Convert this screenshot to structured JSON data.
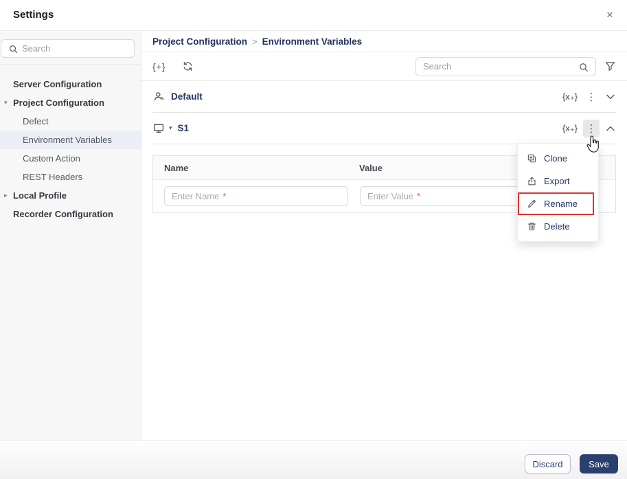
{
  "window": {
    "title": "Settings"
  },
  "icons": {
    "close": "×",
    "braces_add": "{+}",
    "x_add": "{x₊}",
    "kebab": "⋮",
    "caret_down": "▾",
    "caret_right": "▸"
  },
  "sidebar": {
    "search": {
      "placeholder": "Search"
    },
    "items": [
      {
        "label": "Server Configuration"
      },
      {
        "label": "Project Configuration"
      },
      {
        "label": "Defect"
      },
      {
        "label": "Environment Variables"
      },
      {
        "label": "Custom Action"
      },
      {
        "label": "REST Headers"
      },
      {
        "label": "Local Profile"
      },
      {
        "label": "Recorder Configuration"
      }
    ]
  },
  "breadcrumb": {
    "parent": "Project Configuration",
    "separator": ">",
    "current": "Environment Variables"
  },
  "toolbar": {
    "search_placeholder": "Search"
  },
  "sections": [
    {
      "name": "Default",
      "state": "collapsed"
    },
    {
      "name": "S1",
      "state": "expanded"
    }
  ],
  "table": {
    "columns": [
      {
        "label": "Name"
      },
      {
        "label": "Value"
      }
    ],
    "new_row": {
      "name_placeholder": "Enter Name",
      "value_placeholder": "Enter Value",
      "required_mark": "*"
    }
  },
  "context_menu": {
    "items": [
      {
        "label": "Clone"
      },
      {
        "label": "Export"
      },
      {
        "label": "Rename",
        "highlighted": true
      },
      {
        "label": "Delete"
      }
    ]
  },
  "footer": {
    "discard": "Discard",
    "save": "Save"
  },
  "colors": {
    "navy_text": "#22365f",
    "save_bg": "#2a406e",
    "selected_item_bg": "#ebeef7",
    "rename_highlight": "#e23333",
    "required_asterisk": "#e05555"
  }
}
